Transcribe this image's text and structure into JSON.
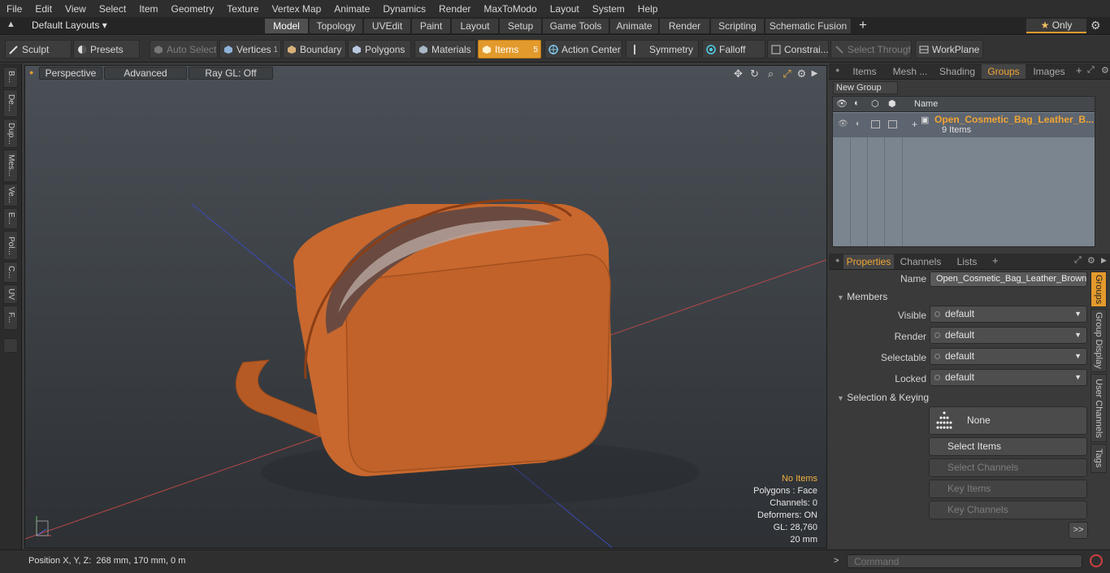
{
  "menu": [
    "File",
    "Edit",
    "View",
    "Select",
    "Item",
    "Geometry",
    "Texture",
    "Vertex Map",
    "Animate",
    "Dynamics",
    "Render",
    "MaxToModo",
    "Layout",
    "System",
    "Help"
  ],
  "layout": {
    "name": "Default Layouts",
    "tabs": [
      "Model",
      "Topology",
      "UVEdit",
      "Paint",
      "Layout",
      "Setup",
      "Game Tools",
      "Animate",
      "Render",
      "Scripting",
      "Schematic Fusion"
    ],
    "only_label": "Only"
  },
  "toolbar": {
    "sculpt": "Sculpt",
    "presets": "Presets",
    "auto_select": "Auto Select",
    "vertices": "Vertices",
    "vertices_count": "1",
    "boundary": "Boundary",
    "polygons": "Polygons",
    "materials": "Materials",
    "items": "Items",
    "items_count": "5",
    "action_center": "Action Center",
    "symmetry": "Symmetry",
    "falloff": "Falloff",
    "constraints": "Constrai...",
    "select_through": "Select Through",
    "workplane": "WorkPlane"
  },
  "left_tools": [
    "B...",
    "De...",
    "Dup...",
    "Mes...",
    "Ve...",
    "E...",
    "Pol...",
    "C...",
    "UV",
    "F..."
  ],
  "viewport": {
    "view": "Perspective",
    "shading": "Advanced",
    "raygl": "Ray GL: Off",
    "info": {
      "selection": "No Items",
      "polygons": "Polygons : Face",
      "channels": "Channels: 0",
      "deformers": "Deformers: ON",
      "gl": "GL: 28,760",
      "size": "20 mm"
    }
  },
  "status": {
    "position": "Position X, Y, Z:  268 mm, 170 mm, 0 m"
  },
  "groups_panel": {
    "tabs": [
      "Items",
      "Mesh ...",
      "Shading",
      "Groups",
      "Images"
    ],
    "new_group": "New Group",
    "col_name": "Name",
    "group_name": "Open_Cosmetic_Bag_Leather_B...",
    "group_items": "9 Items"
  },
  "properties": {
    "tabs": [
      "Properties",
      "Channels",
      "Lists"
    ],
    "name_label": "Name",
    "name_value": "Open_Cosmetic_Bag_Leather_Brown",
    "members": "Members",
    "fields": [
      {
        "label": "Visible",
        "value": "default"
      },
      {
        "label": "Render",
        "value": "default"
      },
      {
        "label": "Selectable",
        "value": "default"
      },
      {
        "label": "Locked",
        "value": "default"
      }
    ],
    "selection_keying": "Selection & Keying",
    "none_btn": "None",
    "select_items": "Select Items",
    "select_channels": "Select Channels",
    "key_items": "Key Items",
    "key_channels": "Key Channels",
    "more": ">>",
    "side_tabs": [
      "Groups",
      "Group Display",
      "User Channels",
      "Tags"
    ]
  },
  "command": {
    "placeholder": "Command"
  },
  "colors": {
    "accent": "#e39a2c",
    "bag": "#c8682e",
    "group_name": "#f0a535"
  }
}
